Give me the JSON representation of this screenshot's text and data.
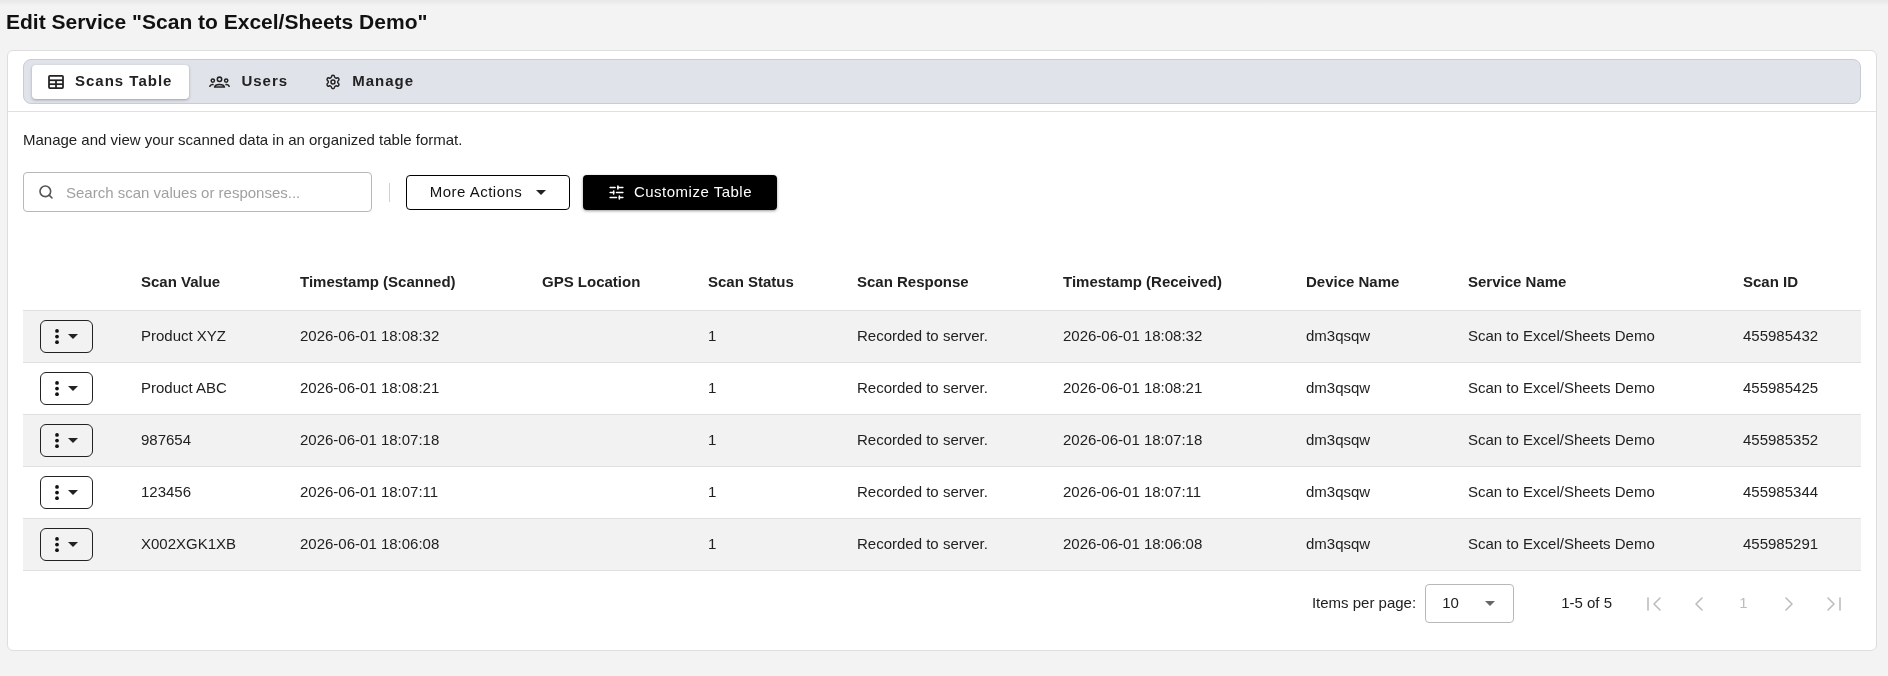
{
  "page": {
    "title": "Edit Service \"Scan to Excel/Sheets Demo\""
  },
  "tabs": [
    {
      "label": "Scans Table",
      "selected": true
    },
    {
      "label": "Users",
      "selected": false
    },
    {
      "label": "Manage",
      "selected": false
    }
  ],
  "description": "Manage and view your scanned data in an organized table format.",
  "search": {
    "placeholder": "Search scan values or responses..."
  },
  "more_actions": {
    "label": "More Actions"
  },
  "customize": {
    "label": "Customize Table"
  },
  "table": {
    "columns": [
      "Scan Value",
      "Timestamp (Scanned)",
      "GPS Location",
      "Scan Status",
      "Scan Response",
      "Timestamp (Received)",
      "Device Name",
      "Service Name",
      "Scan ID"
    ],
    "rows": [
      {
        "scan_value": "Product XYZ",
        "timestamp_scanned": "2026-06-01 18:08:32",
        "scan_status": "1",
        "scan_response": "Recorded to server.",
        "timestamp_received": "2026-06-01 18:08:32",
        "device_name": "dm3qsqw",
        "service_name": "Scan to Excel/Sheets Demo",
        "scan_id": "455985432"
      },
      {
        "scan_value": "Product ABC",
        "timestamp_scanned": "2026-06-01 18:08:21",
        "scan_status": "1",
        "scan_response": "Recorded to server.",
        "timestamp_received": "2026-06-01 18:08:21",
        "device_name": "dm3qsqw",
        "service_name": "Scan to Excel/Sheets Demo",
        "scan_id": "455985425"
      },
      {
        "scan_value": "987654",
        "timestamp_scanned": "2026-06-01 18:07:18",
        "scan_status": "1",
        "scan_response": "Recorded to server.",
        "timestamp_received": "2026-06-01 18:07:18",
        "device_name": "dm3qsqw",
        "service_name": "Scan to Excel/Sheets Demo",
        "scan_id": "455985352"
      },
      {
        "scan_value": "123456",
        "timestamp_scanned": "2026-06-01 18:07:11",
        "scan_status": "1",
        "scan_response": "Recorded to server.",
        "timestamp_received": "2026-06-01 18:07:11",
        "device_name": "dm3qsqw",
        "service_name": "Scan to Excel/Sheets Demo",
        "scan_id": "455985344"
      },
      {
        "scan_value": "X002XGK1XB",
        "timestamp_scanned": "2026-06-01 18:06:08",
        "scan_status": "1",
        "scan_response": "Recorded to server.",
        "timestamp_received": "2026-06-01 18:06:08",
        "device_name": "dm3qsqw",
        "service_name": "Scan to Excel/Sheets Demo",
        "scan_id": "455985291"
      }
    ]
  },
  "pagination": {
    "items_per_page_label": "Items per page:",
    "page_size": "10",
    "range": "1-5 of 5",
    "nav": [
      {
        "kind": "first",
        "disabled": true
      },
      {
        "kind": "previous",
        "disabled": true
      },
      {
        "kind": "page",
        "label": "1",
        "disabled": true
      },
      {
        "kind": "next",
        "disabled": true
      },
      {
        "kind": "last",
        "disabled": true
      }
    ]
  }
}
